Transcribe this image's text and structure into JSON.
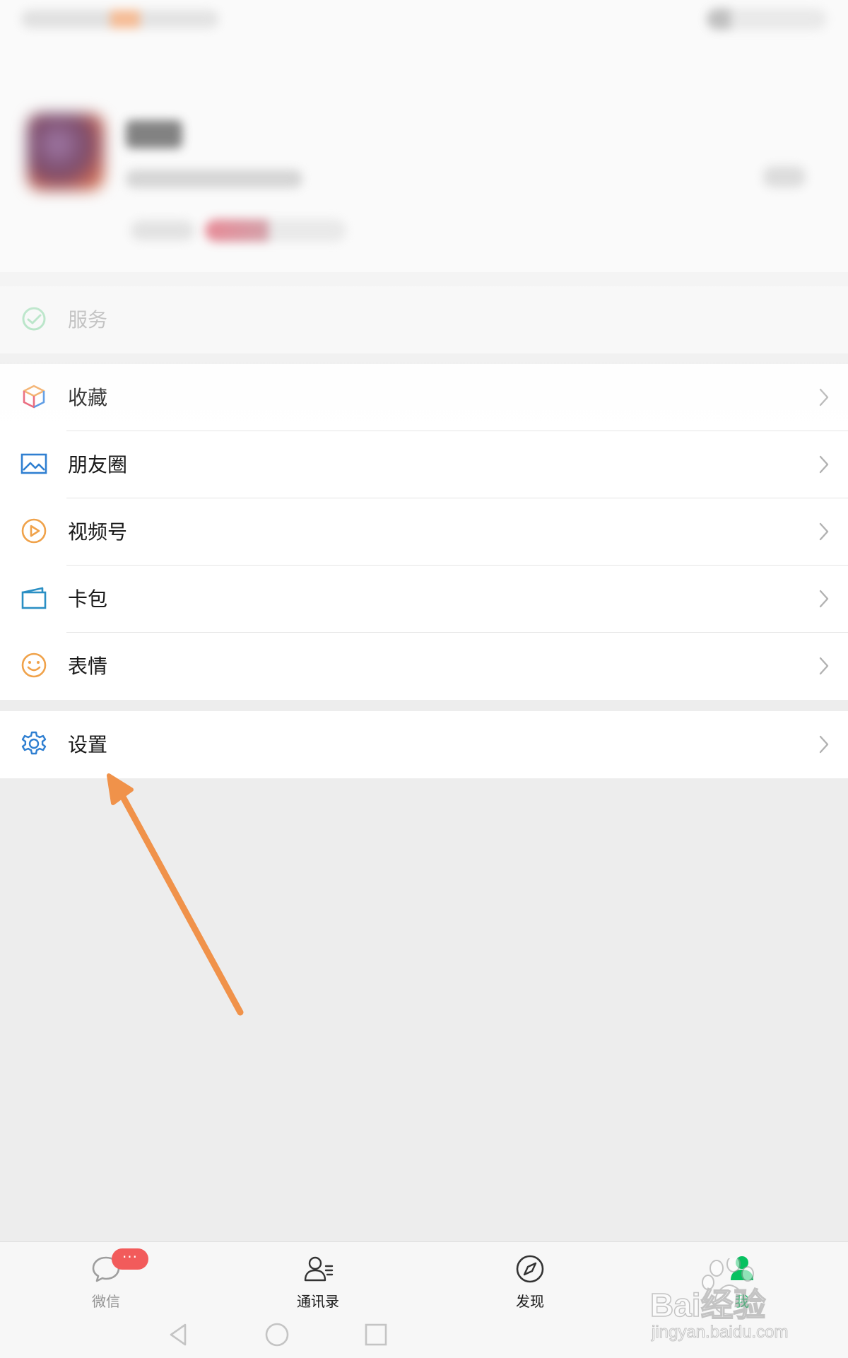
{
  "profile": {
    "avatar": "avatar",
    "nickname": "",
    "wechat_id": ""
  },
  "menu": {
    "services": {
      "label": "服务",
      "icon": "service-icon"
    },
    "items": [
      {
        "label": "收藏",
        "icon": "favorites-cube-icon"
      },
      {
        "label": "朋友圈",
        "icon": "moments-image-icon"
      },
      {
        "label": "视频号",
        "icon": "channels-play-icon"
      },
      {
        "label": "卡包",
        "icon": "card-wallet-icon"
      },
      {
        "label": "表情",
        "icon": "sticker-smile-icon"
      }
    ],
    "settings": {
      "label": "设置",
      "icon": "gear-icon"
    }
  },
  "tabbar": {
    "badge": "···",
    "tabs": [
      {
        "label": "微信",
        "icon": "chat-bubble-icon"
      },
      {
        "label": "通讯录",
        "icon": "contacts-icon"
      },
      {
        "label": "发现",
        "icon": "compass-icon"
      },
      {
        "label": "我",
        "icon": "me-person-icon"
      }
    ]
  },
  "watermark": {
    "brand": "Bai经验",
    "url": "jingyan.baidu.com"
  },
  "colors": {
    "accent": "#07C160",
    "annotation_arrow": "#F0924A",
    "background": "#EDEDED",
    "badge": "#F25B5B"
  }
}
